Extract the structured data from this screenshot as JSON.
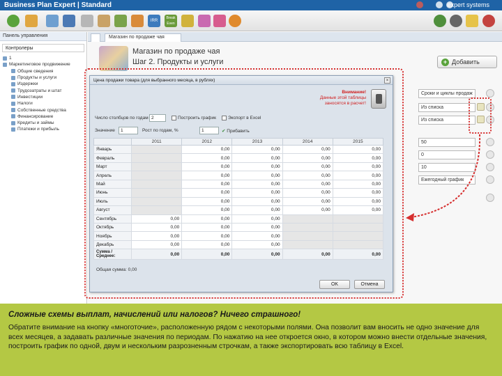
{
  "app": {
    "title": "Business Plan Expert",
    "edition": "| Standard",
    "brand": "expert systems"
  },
  "toolbar": {
    "items": [
      "add",
      "copy",
      "save",
      "settings",
      "edit",
      "import",
      "export",
      "IRR",
      "Break Even",
      "profit",
      "chart",
      "run"
    ],
    "tb_irr": "IRR",
    "tb_break": "Break Even"
  },
  "left": {
    "header": "Панель управления",
    "subheader": "Контролеры",
    "tree": [
      "1",
      "Маркетинговое продвижение",
      "Общие сведения",
      "Продукты и услуги",
      "Издержки",
      "Трудозатраты и штат",
      "Инвестиции",
      "Налоги",
      "Собственные средства",
      "Финансирование",
      "Кредиты и займы",
      "Платежи и прибыль"
    ]
  },
  "main": {
    "tab": "Магазин по продаже чая",
    "title_line1": "Магазин по продаже чая",
    "title_line2": "Шаг 2. Продукты и услуги",
    "add_button": "Добавить",
    "right_fields": [
      "Сроки и циклы продаж",
      "Из списка",
      "Из списка",
      "50",
      "0",
      "10",
      "Ежегодный график"
    ]
  },
  "dialog": {
    "title": "Цена продажи товара (для выбранного месяца, в рублях)",
    "warning": [
      "Внимание!",
      "Данные этой таблицы",
      "заносятся в расчет!"
    ],
    "row1": {
      "label": "Число столбцов по годам",
      "value": "2",
      "check1": "Построить график",
      "check2": "Экспорт в Excel"
    },
    "row2": {
      "label1": "Значение",
      "value1": "1",
      "label2": "Рост по годам, %",
      "value2": "1",
      "label3": "Прибавить",
      "value3": "1"
    },
    "columns": [
      "",
      "2011",
      "2012",
      "2013",
      "2014",
      "2015"
    ],
    "rows": [
      {
        "m": "Январь",
        "v": [
          "",
          "0,00",
          "0,00",
          "0,00",
          "0,00"
        ]
      },
      {
        "m": "Февраль",
        "v": [
          "",
          "0,00",
          "0,00",
          "0,00",
          "0,00"
        ]
      },
      {
        "m": "Март",
        "v": [
          "",
          "0,00",
          "0,00",
          "0,00",
          "0,00"
        ]
      },
      {
        "m": "Апрель",
        "v": [
          "",
          "0,00",
          "0,00",
          "0,00",
          "0,00"
        ]
      },
      {
        "m": "Май",
        "v": [
          "",
          "0,00",
          "0,00",
          "0,00",
          "0,00"
        ]
      },
      {
        "m": "Июнь",
        "v": [
          "",
          "0,00",
          "0,00",
          "0,00",
          "0,00"
        ]
      },
      {
        "m": "Июль",
        "v": [
          "",
          "0,00",
          "0,00",
          "0,00",
          "0,00"
        ]
      },
      {
        "m": "Август",
        "v": [
          "",
          "0,00",
          "0,00",
          "0,00",
          "0,00"
        ]
      },
      {
        "m": "Сентябрь",
        "v": [
          "0,00",
          "0,00",
          "0,00",
          "",
          ""
        ]
      },
      {
        "m": "Октябрь",
        "v": [
          "0,00",
          "0,00",
          "0,00",
          "",
          ""
        ]
      },
      {
        "m": "Ноябрь",
        "v": [
          "0,00",
          "0,00",
          "0,00",
          "",
          ""
        ]
      },
      {
        "m": "Декабрь",
        "v": [
          "0,00",
          "0,00",
          "0,00",
          "",
          ""
        ]
      }
    ],
    "sum_label": "Сумма / Среднее:",
    "sums": [
      "0,00",
      "0,00",
      "0,00",
      "0,00",
      "0,00"
    ],
    "footnote": "Общая сумма: 0,00",
    "ok": "OK",
    "cancel": "Отмена"
  },
  "bottom": {
    "heading": "Сложные схемы выплат, начислений или налогов? Ничего страшного!",
    "text": "Обратите внимание на кнопку «многоточие», расположенную рядом с некоторыми полями. Она позволит вам вносить не одно значение для всех месяцев, а задавать различные значения по периодам. По нажатию на нее откроется окно, в котором можно внести отдельные значения, построить график по одной, двум и нескольким разрозненным строчкам, а также экспортировать всю таблицу в Excel."
  },
  "colors": {
    "titlebar": "#1f63a6",
    "highlight": "#d62f2f",
    "banner": "#b4c844"
  }
}
